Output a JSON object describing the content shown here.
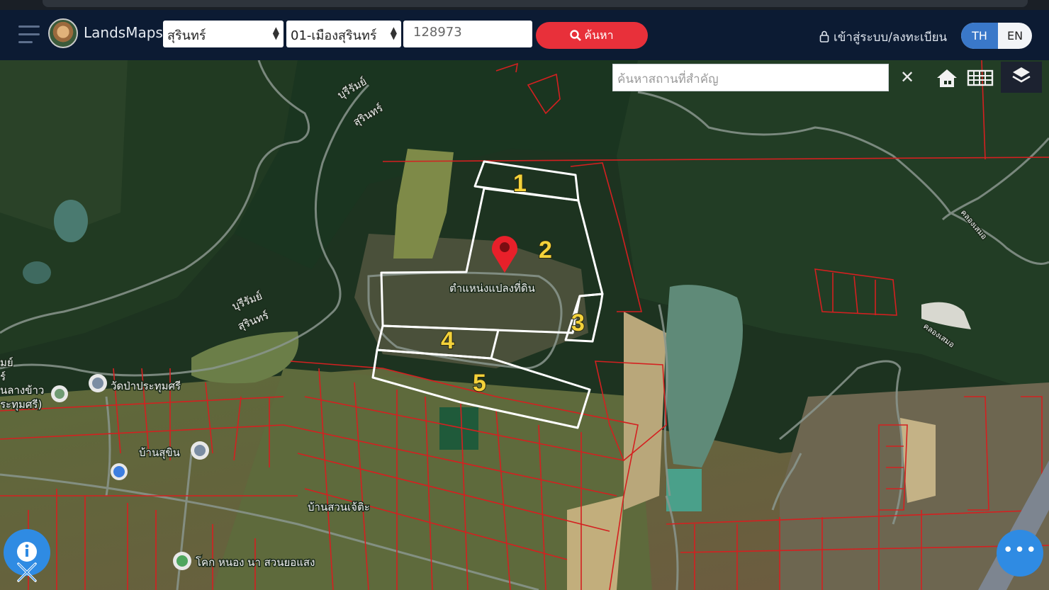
{
  "header": {
    "brand": "LandsMaps",
    "province_select": "สุรินทร์",
    "district_select": "01-เมืองสุรินทร์",
    "parcel_number": "128973",
    "search_button": "ค้นหา",
    "login_link": "เข้าสู่ระบบ/ลงทะเบียน",
    "lang_th": "TH",
    "lang_en": "EN"
  },
  "map": {
    "place_search_placeholder": "ค้นหาสถานที่สำคัญ",
    "clear_symbol": "✕",
    "marker_label": "ตำแหน่งแปลงที่ดิน",
    "plot_numbers": [
      "1",
      "2",
      "3",
      "4",
      "5"
    ],
    "road_labels": {
      "buriram_1": "บุรีรัมย์",
      "surin_1": "สุรินทร์",
      "buriram_2": "บุรีรัมย์",
      "surin_2": "สุรินทร์",
      "road_edge_1": "มย์",
      "road_edge_2": "ร์"
    },
    "place_labels": {
      "wat": "วัดป่าประทุมศรี",
      "ban_sukhin": "บ้านสุขิน",
      "ban_suan_chek": "บ้านสวนเจ้ติะ",
      "school": "โคก หนอง นา สวนยอแสง",
      "left_edge_1": "นลางข้าว",
      "left_edge_2": "ระทุมศรี)",
      "canal_1": "คลองเสมอ",
      "canal_2": "คลองเสมอ"
    },
    "colors": {
      "parcel_outline": "#ffffff",
      "cadastral": "#d42020",
      "marker": "#e8202a",
      "plot_number": "#f4d23a"
    }
  },
  "icons": {
    "menu": "hamburger-icon",
    "search": "magnifier-icon",
    "lock": "lock-icon",
    "home": "home-icon",
    "grid": "grid-icon",
    "layers": "layers-icon",
    "more": "more-icon",
    "info": "info-icon",
    "tools": "crossed-tools-icon"
  }
}
